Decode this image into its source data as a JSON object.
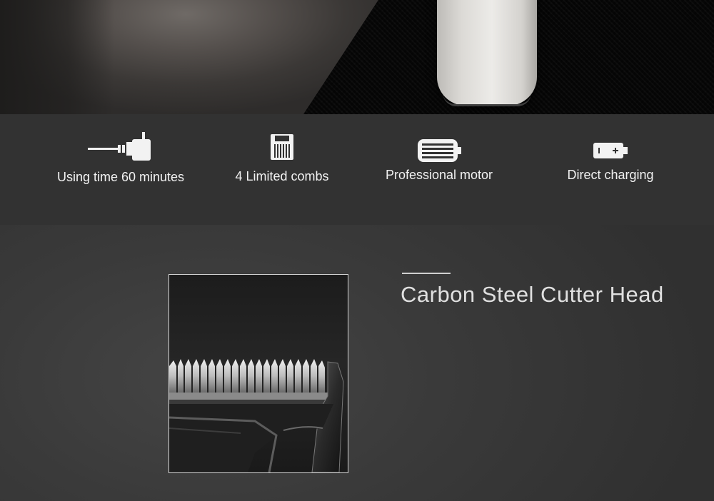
{
  "hero": {
    "image": "trimmer-on-carbon-fiber-photo"
  },
  "features": [
    {
      "icon": "charging-cable-icon",
      "label": "Using time 60 minutes"
    },
    {
      "icon": "limit-comb-icon",
      "label": "4 Limited combs"
    },
    {
      "icon": "motor-icon",
      "label": "Professional motor"
    },
    {
      "icon": "battery-icon",
      "label": "Direct charging"
    }
  ],
  "detail": {
    "title": "Carbon Steel Cutter Head",
    "image": "cutter-head-closeup-photo"
  },
  "colors": {
    "feature_band": "#323232",
    "text": "#f2f2f2",
    "title": "#e0e0e0"
  }
}
